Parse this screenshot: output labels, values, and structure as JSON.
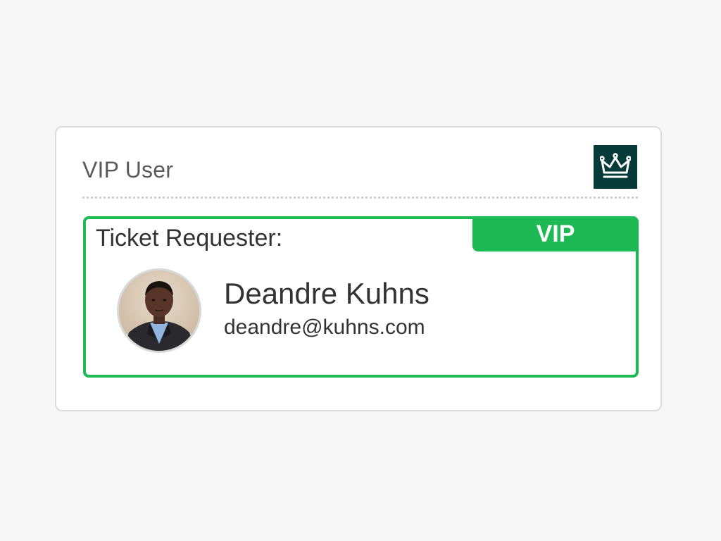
{
  "card": {
    "title": "VIP User",
    "crown_icon": "crown-icon"
  },
  "requester": {
    "label": "Ticket Requester:",
    "badge": "VIP",
    "name": "Deandre Kuhns",
    "email": "deandre@kuhns.com"
  },
  "colors": {
    "accent_green": "#1db954",
    "crown_bg": "#073b3a"
  }
}
